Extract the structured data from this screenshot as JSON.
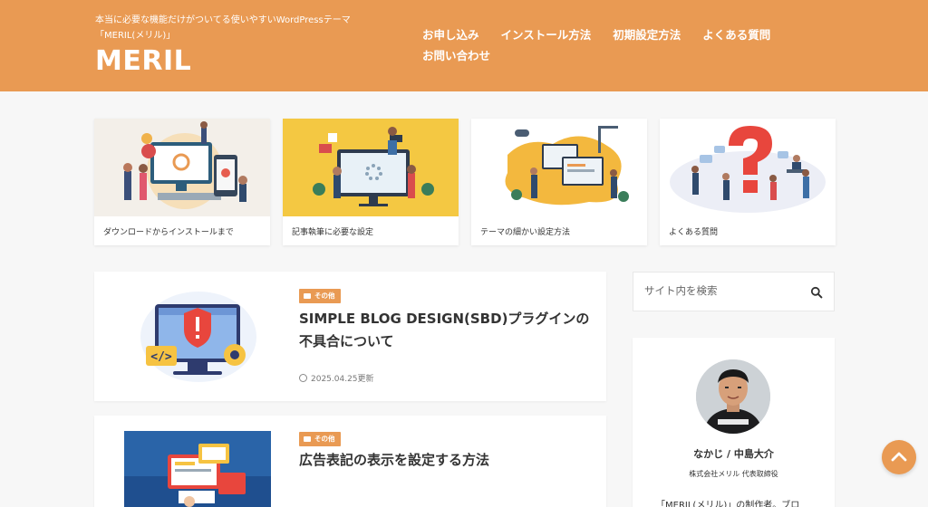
{
  "site": {
    "tagline": "本当に必要な機能だけがついてる使いやすいWordPressテーマ「MERIL(メリル)」",
    "logo": "MERIL"
  },
  "nav": [
    {
      "label": "お申し込み"
    },
    {
      "label": "インストール方法"
    },
    {
      "label": "初期設定方法"
    },
    {
      "label": "よくある質問"
    },
    {
      "label": "お問い合わせ"
    }
  ],
  "cards": [
    {
      "caption": "ダウンロードからインストールまで"
    },
    {
      "caption": "記事執筆に必要な設定"
    },
    {
      "caption": "テーマの細かい設定方法"
    },
    {
      "caption": "よくある質問"
    }
  ],
  "posts": [
    {
      "category": "その他",
      "title": "SIMPLE BLOG DESIGN(SBD)プラグインの不具合について",
      "date": "2025.04.25更新"
    },
    {
      "category": "その他",
      "title": "広告表記の表示を設定する方法",
      "date": ""
    }
  ],
  "search": {
    "placeholder": "サイト内を検索"
  },
  "profile": {
    "name": "なかじ / 中島大介",
    "role": "株式会社メリル 代表取締役",
    "bio": "「MERIL(メリル)」の制作者。ブロ"
  },
  "colors": {
    "accent": "#e99a53",
    "background": "#f7f7f7"
  },
  "icons": {
    "search": "search-icon",
    "folder": "folder-icon",
    "clock": "clock-icon",
    "totop": "chevron-up-icon"
  }
}
